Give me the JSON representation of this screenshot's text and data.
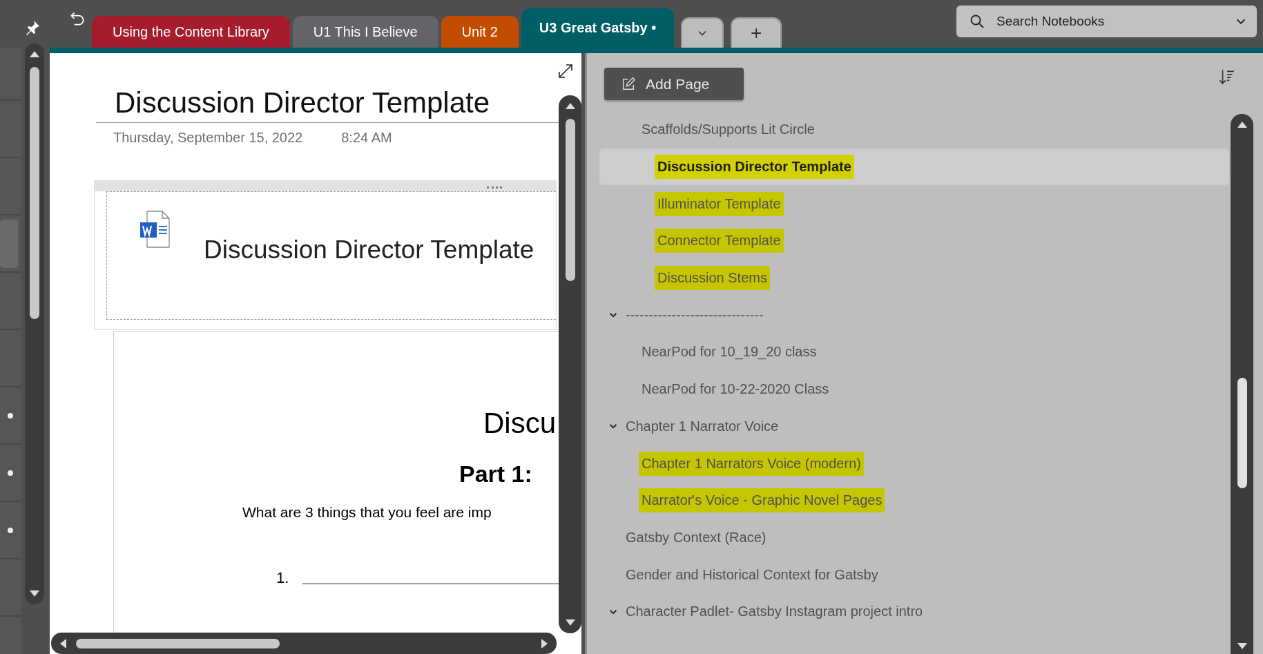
{
  "tabs": [
    {
      "label": "Using the Content Library",
      "color": "#a51d2d",
      "selected": false
    },
    {
      "label": "U1 This I Believe",
      "color": "#636368",
      "selected": false
    },
    {
      "label": "Unit 2",
      "color": "#c24c00",
      "selected": false
    },
    {
      "label": "U3 Great Gatsby",
      "color": "#005e66",
      "selected": true,
      "badge": "•"
    }
  ],
  "new_tab": "+",
  "search": {
    "placeholder": "Search Notebooks"
  },
  "page": {
    "title": "Discussion Director Template",
    "date": "Thursday, September 15, 2022",
    "time": "8:24 AM",
    "attachment": {
      "file_name": "Discussion Director Template"
    },
    "document": {
      "heading": "Discu",
      "subheading": "Part 1:",
      "question": "What are 3 things that you feel are imp",
      "list_number": "1."
    }
  },
  "page_list": {
    "add_button": "Add Page",
    "pages": [
      {
        "children": [
          {
            "title": "Scaffolds/Supports Lit Circle",
            "selected": false,
            "highlighted": false,
            "children": [
              {
                "title": "Discussion Director Template",
                "selected": true,
                "highlighted": true
              },
              {
                "title": "Illuminator Template",
                "selected": false,
                "highlighted": true
              },
              {
                "title": "Connector Template",
                "selected": false,
                "highlighted": true
              },
              {
                "title": "Discussion Stems",
                "selected": false,
                "highlighted": true
              }
            ]
          }
        ]
      },
      {
        "title": "------------------------------",
        "selected": false,
        "highlighted": false,
        "expanded": true,
        "children": [
          {
            "title": "NearPod for 10_19_20 class",
            "selected": false,
            "highlighted": false
          },
          {
            "title": "NearPod for 10-22-2020 Class",
            "selected": false,
            "highlighted": false
          }
        ]
      },
      {
        "title": "Chapter 1 Narrator Voice",
        "selected": false,
        "highlighted": false,
        "expanded": true,
        "children": [
          {
            "title": "Chapter 1 Narrators Voice (modern)",
            "selected": false,
            "highlighted": true
          },
          {
            "title": "Narrator's Voice - Graphic Novel Pages",
            "selected": false,
            "highlighted": true
          }
        ]
      },
      {
        "title": "Gatsby Context (Race)",
        "selected": false,
        "highlighted": false
      },
      {
        "title": "Gender and Historical Context for Gatsby",
        "selected": false,
        "highlighted": false
      },
      {
        "title": "Character Padlet- Gatsby Instagram project intro",
        "selected": false,
        "highlighted": false,
        "expanded": true
      }
    ]
  }
}
